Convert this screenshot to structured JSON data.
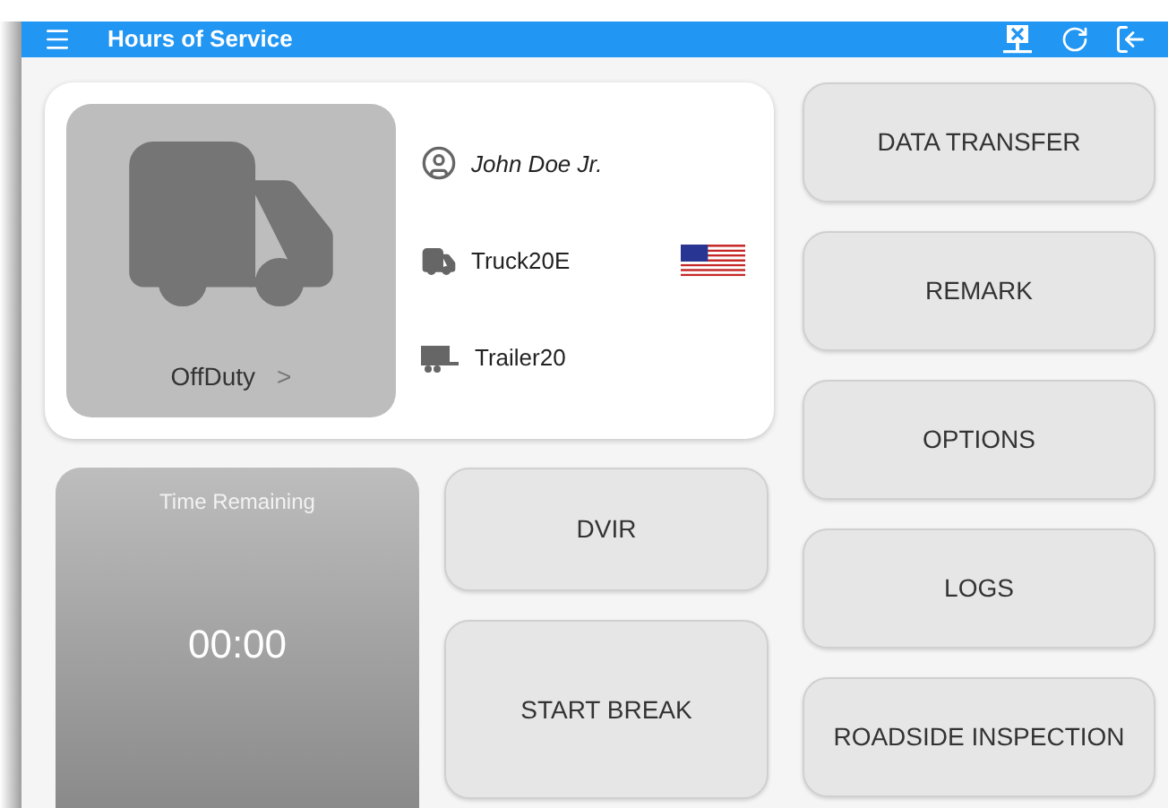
{
  "app_bar": {
    "title": "Hours of Service"
  },
  "status_card": {
    "duty_status": "OffDuty",
    "chevron": ">",
    "driver": "John Doe Jr.",
    "truck": "Truck20E",
    "trailer": "Trailer20"
  },
  "timer": {
    "label": "Time Remaining",
    "value": "00:00"
  },
  "center_buttons": [
    "DVIR",
    "START BREAK"
  ],
  "side_buttons": [
    "DATA TRANSFER",
    "REMARK",
    "OPTIONS",
    "LOGS",
    "ROADSIDE INSPECTION"
  ]
}
